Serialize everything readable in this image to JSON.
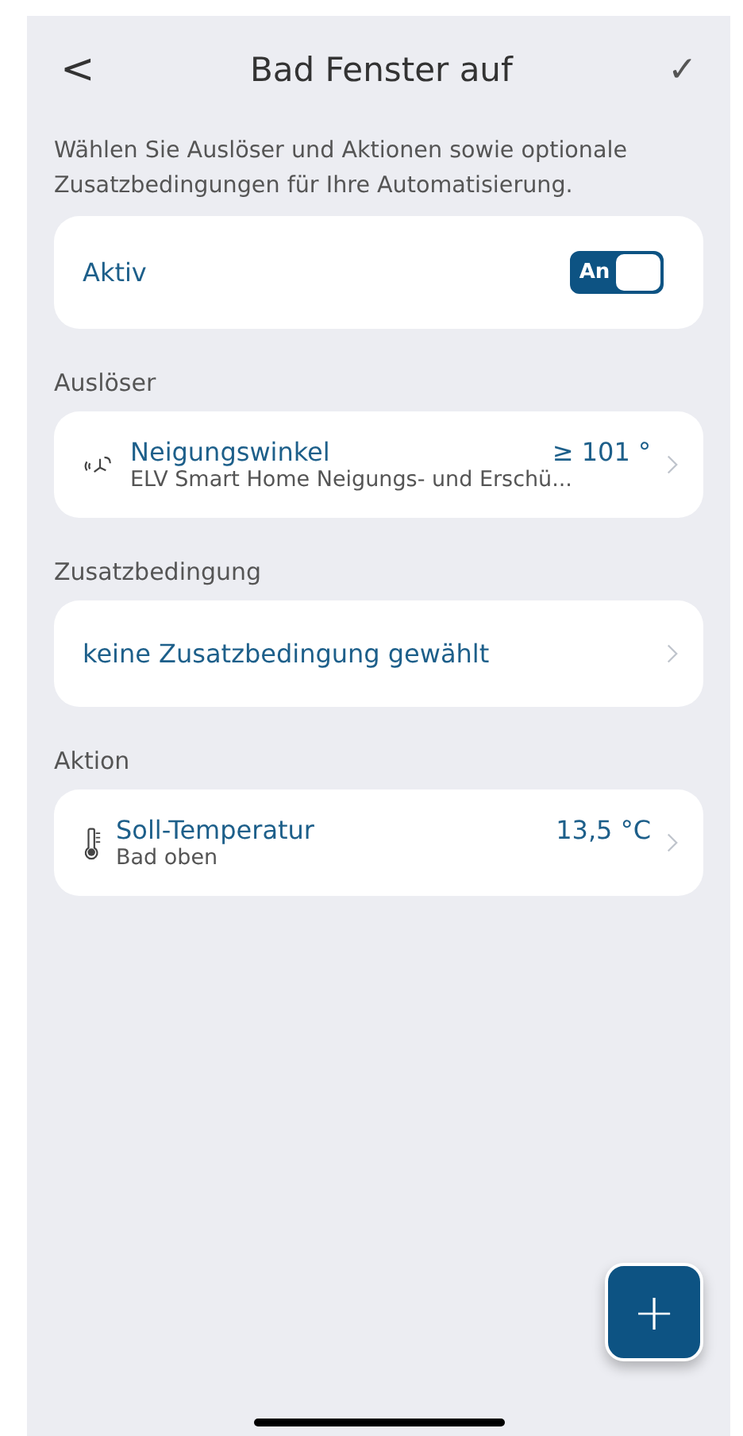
{
  "header": {
    "back": "<",
    "title": "Bad Fenster auf",
    "confirm": "✓"
  },
  "description": "Wählen Sie Auslöser und Aktionen sowie optionale Zusatzbedingungen für Ihre Automatisierung.",
  "active": {
    "label": "Aktiv",
    "toggle_label": "An",
    "on": true
  },
  "sections": [
    {
      "label": "Auslöser",
      "items": [
        {
          "kind": "tilt",
          "title": "Neigungswinkel",
          "value": "≥ 101 °",
          "subtitle": "ELV Smart Home Neigungs- und Erschü..."
        }
      ]
    },
    {
      "label": "Zusatzbedingung",
      "items": [
        {
          "kind": "plain",
          "title": "keine Zusatzbedingung gewählt"
        }
      ]
    },
    {
      "label": "Aktion",
      "items": [
        {
          "kind": "thermometer",
          "title": "Soll-Temperatur",
          "value": "13,5 °C",
          "subtitle": "Bad oben"
        }
      ]
    }
  ],
  "fab": "+"
}
